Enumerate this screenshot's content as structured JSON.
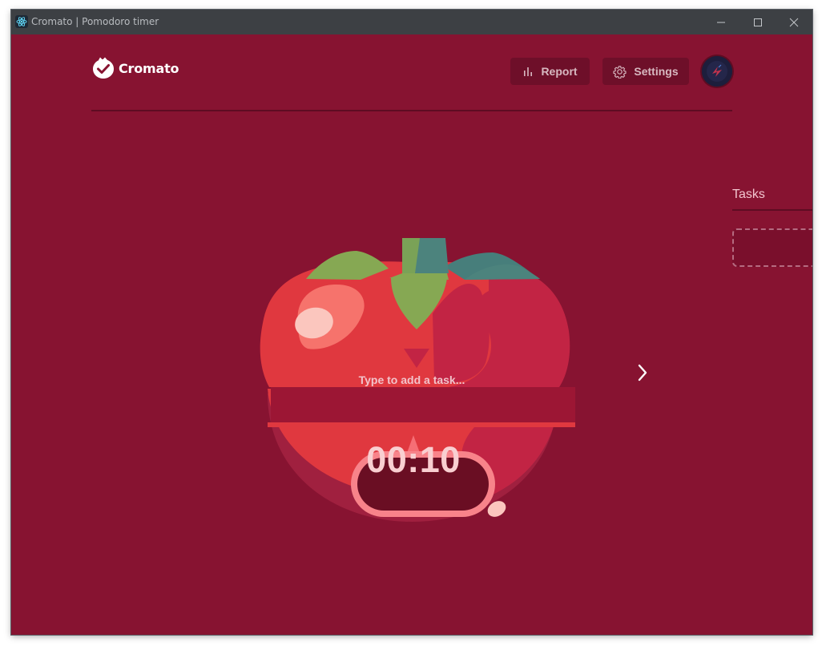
{
  "window": {
    "title": "Cromato | Pomodoro timer"
  },
  "header": {
    "logo_text": "Cromato",
    "report_label": "Report",
    "settings_label": "Settings"
  },
  "timer": {
    "task_placeholder": "Type to add a task...",
    "time": "00:10"
  },
  "tasks": {
    "title": "Tasks"
  },
  "icons": {
    "app": "react-atom-icon",
    "logo": "check-badge-icon",
    "report": "bar-chart-icon",
    "settings": "gear-icon",
    "next": "chevron-right-icon",
    "minimize": "minimize-icon",
    "maximize": "maximize-icon",
    "close": "close-icon"
  },
  "colors": {
    "background": "#871331",
    "titlebar": "#3d4044",
    "button_bg": "#6e0f29",
    "tomato_red": "#e0383f",
    "leaf_green": "#86a853"
  }
}
